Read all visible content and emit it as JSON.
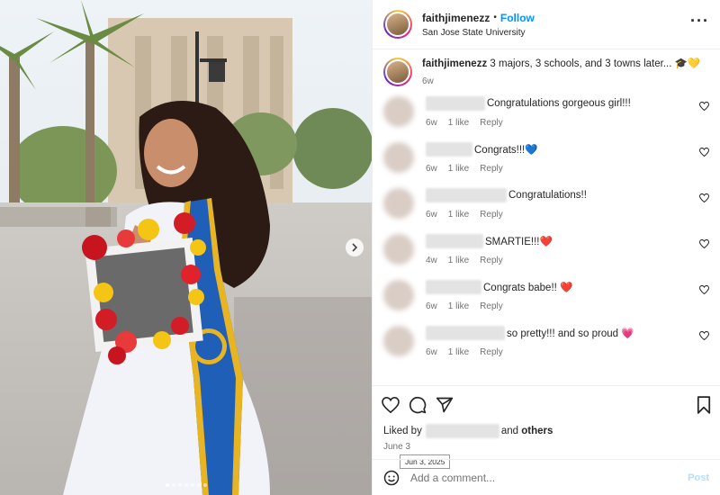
{
  "post": {
    "username": "faithjimenezz",
    "follow_label": "Follow",
    "separator": "•",
    "location": "San Jose State University",
    "more_icon": "more-horizontal-icon"
  },
  "caption": {
    "username": "faithjimenezz",
    "text": "3 majors, 3 schools, and 3 towns later... 🎓💛",
    "time": "6w"
  },
  "comments": [
    {
      "text": "Congratulations gorgeous girl!!!",
      "time": "6w",
      "likes": "1 like",
      "reply": "Reply"
    },
    {
      "text": "Congrats!!!💙",
      "time": "6w",
      "likes": "1 like",
      "reply": "Reply"
    },
    {
      "text": "Congratulations!!",
      "time": "6w",
      "likes": "1 like",
      "reply": "Reply"
    },
    {
      "text": "SMARTIE!!!❤️",
      "time": "4w",
      "likes": "1 like",
      "reply": "Reply"
    },
    {
      "text": "Congrats babe!! ❤️",
      "time": "6w",
      "likes": "1 like",
      "reply": "Reply"
    },
    {
      "text": "so pretty!!! and so proud 💗",
      "time": "6w",
      "likes": "1 like",
      "reply": "Reply"
    }
  ],
  "likes": {
    "prefix": "Liked by",
    "suffix": "and",
    "others": "others"
  },
  "date": "June 3",
  "tooltip": "Jun 3, 2025",
  "add_comment": {
    "placeholder": "Add a comment...",
    "post_label": "Post"
  },
  "carousel": {
    "slide_count": 7,
    "active_index": 0
  },
  "colors": {
    "follow": "#0095f6",
    "post_disabled": "#b2dffc",
    "sash": "#1f5fb8"
  }
}
